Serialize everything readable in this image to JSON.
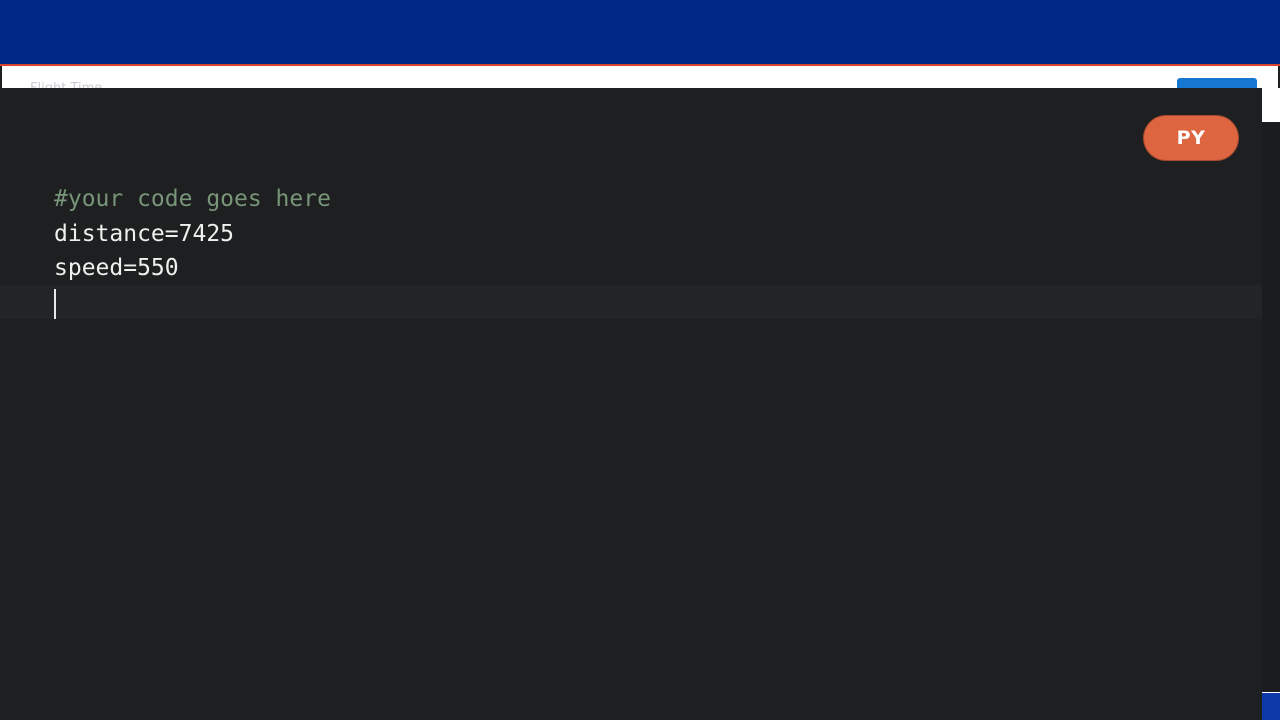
{
  "header": {
    "faint_title": "Flight Time",
    "accent_color": "#012887",
    "border_color": "#d6452e"
  },
  "editor": {
    "language_badge": "PY",
    "badge_color": "#dd6540",
    "background": "#1d1f20",
    "lines": [
      "#your code goes here",
      "distance=7425",
      "speed=550",
      ""
    ],
    "cursor_line": 4
  }
}
